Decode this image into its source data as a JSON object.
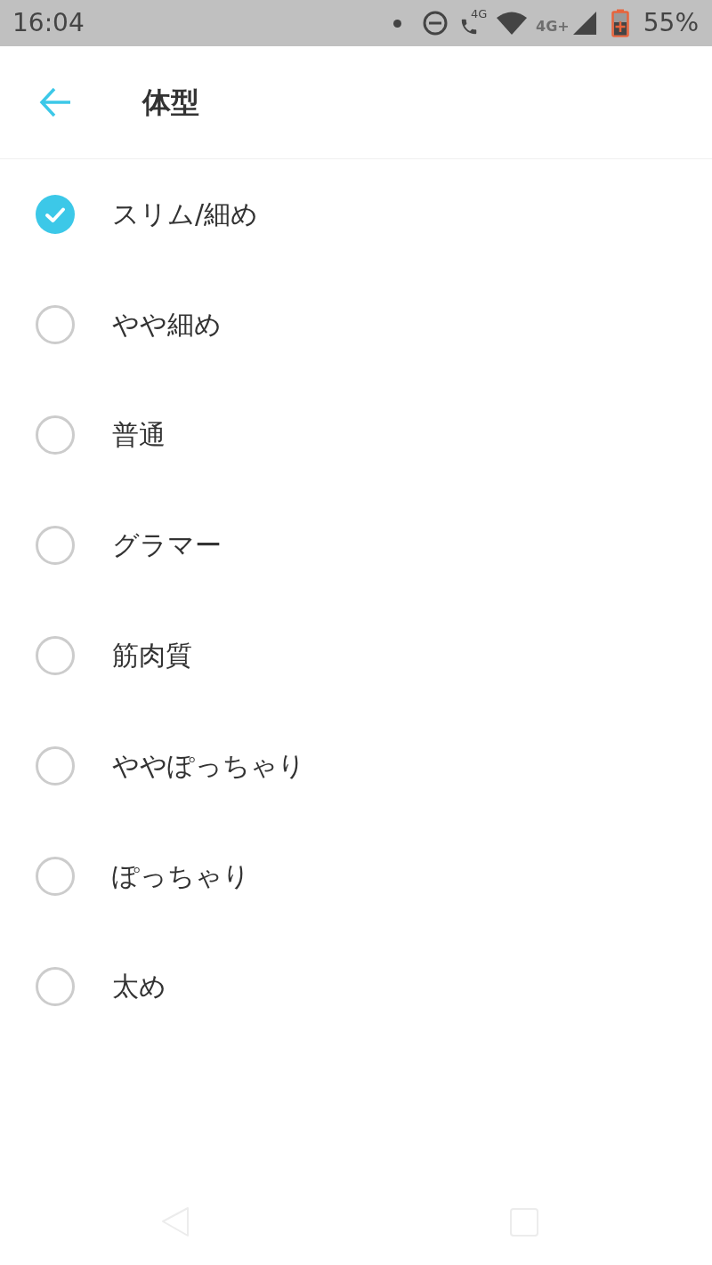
{
  "status_bar": {
    "time": "16:04",
    "call_badge": "4G",
    "network_type": "4G+",
    "battery": "55%"
  },
  "header": {
    "title": "体型"
  },
  "options": [
    {
      "label": "スリム/細め",
      "selected": true
    },
    {
      "label": "やや細め",
      "selected": false
    },
    {
      "label": "普通",
      "selected": false
    },
    {
      "label": "グラマー",
      "selected": false
    },
    {
      "label": "筋肉質",
      "selected": false
    },
    {
      "label": "ややぽっちゃり",
      "selected": false
    },
    {
      "label": "ぽっちゃり",
      "selected": false
    },
    {
      "label": "太め",
      "selected": false
    }
  ]
}
